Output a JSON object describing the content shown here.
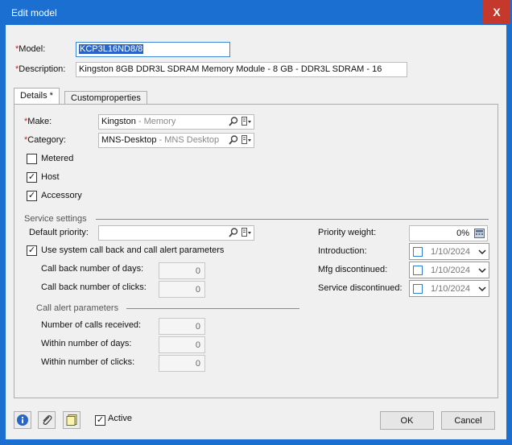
{
  "window": {
    "title": "Edit model",
    "close_glyph": "X"
  },
  "header": {
    "model_label": "Model:",
    "model_value": "KCP3L16ND8/8",
    "description_label": "Description:",
    "description_value": "Kingston 8GB DDR3L SDRAM Memory Module - 8 GB - DDR3L SDRAM - 16",
    "required_marker": "*"
  },
  "tabs": [
    {
      "label": "Details *",
      "active": true
    },
    {
      "label": "Customproperties",
      "active": false
    }
  ],
  "details": {
    "make_label": "Make:",
    "make_value": "Kingston",
    "make_hint": " - Memory",
    "category_label": "Category:",
    "category_value": "MNS-Desktop",
    "category_hint": " - MNS Desktop",
    "metered_label": "Metered",
    "metered_checked": false,
    "host_label": "Host",
    "host_checked": true,
    "accessory_label": "Accessory",
    "accessory_checked": true,
    "check_glyph": "✓"
  },
  "service": {
    "section_label": "Service settings",
    "default_priority_label": "Default priority:",
    "default_priority_value": "",
    "use_system_label": "Use system call back and call alert parameters",
    "use_system_checked": true,
    "callback_days_label": "Call back number of days:",
    "callback_days_value": "0",
    "callback_clicks_label": "Call back number of clicks:",
    "callback_clicks_value": "0",
    "alert_section_label": "Call alert parameters",
    "calls_received_label": "Number of calls received:",
    "calls_received_value": "0",
    "within_days_label": "Within number of days:",
    "within_days_value": "0",
    "within_clicks_label": "Within number of clicks:",
    "within_clicks_value": "0",
    "priority_weight_label": "Priority weight:",
    "priority_weight_value": "0%",
    "introduction_label": "Introduction:",
    "introduction_value": "1/10/2024",
    "mfg_discontinued_label": "Mfg discontinued:",
    "mfg_discontinued_value": "1/10/2024",
    "service_discontinued_label": "Service discontinued:",
    "service_discontinued_value": "1/10/2024"
  },
  "footer": {
    "active_label": "Active",
    "active_checked": true,
    "ok_label": "OK",
    "cancel_label": "Cancel"
  },
  "colors": {
    "title_bar": "#1b6fd0",
    "close_button": "#c4392b",
    "required": "#d02020",
    "selection": "#2a64c6"
  }
}
